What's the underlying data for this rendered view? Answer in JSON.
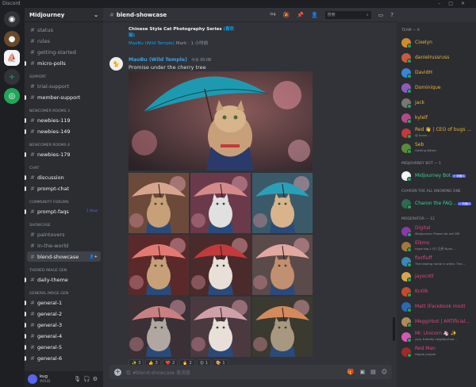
{
  "window": {
    "title": "Discord"
  },
  "server": {
    "name": "Midjourney"
  },
  "channel_categories": [
    {
      "name": "",
      "channels": [
        {
          "name": "status",
          "state": "normal"
        },
        {
          "name": "rules",
          "state": "normal"
        },
        {
          "name": "getting-started",
          "state": "normal"
        },
        {
          "name": "micro-polls",
          "state": "unread"
        }
      ]
    },
    {
      "name": "SUPPORT",
      "channels": [
        {
          "name": "trial-support",
          "state": "normal"
        },
        {
          "name": "member-support",
          "state": "unread"
        }
      ]
    },
    {
      "name": "NEWCOMER ROOMS 3",
      "channels": [
        {
          "name": "newbies-119",
          "state": "unread"
        },
        {
          "name": "newbies-149",
          "state": "unread"
        }
      ]
    },
    {
      "name": "NEWCOMER ROOMS 4",
      "channels": [
        {
          "name": "newbies-179",
          "state": "unread"
        }
      ]
    },
    {
      "name": "CHAT",
      "channels": [
        {
          "name": "discussion",
          "state": "unread"
        },
        {
          "name": "prompt-chat",
          "state": "unread"
        }
      ]
    },
    {
      "name": "COMMUNITY FORUMS",
      "channels": [
        {
          "name": "prompt-faqs",
          "state": "unread",
          "badge": "1 New"
        }
      ]
    },
    {
      "name": "SHOWCASE",
      "channels": [
        {
          "name": "paintovers",
          "state": "normal"
        },
        {
          "name": "in-the-world",
          "state": "normal"
        },
        {
          "name": "blend-showcase",
          "state": "active"
        }
      ]
    },
    {
      "name": "THEMED IMAGE GEN",
      "channels": [
        {
          "name": "daily-theme",
          "state": "unread"
        }
      ]
    },
    {
      "name": "GENERAL IMAGE GEN",
      "channels": [
        {
          "name": "general-1",
          "state": "unread"
        },
        {
          "name": "general-2",
          "state": "unread"
        },
        {
          "name": "general-3",
          "state": "unread"
        },
        {
          "name": "general-4",
          "state": "unread"
        },
        {
          "name": "general-5",
          "state": "unread"
        },
        {
          "name": "general-6",
          "state": "unread"
        }
      ]
    }
  ],
  "user": {
    "name": "kug",
    "tag": "#0142"
  },
  "header": {
    "channel": "blend-showcase",
    "thread_count": "4",
    "search_placeholder": "搜索"
  },
  "reply": {
    "title": "Chinese Style Cat Photography Series",
    "title_tag": "(喜欢猫)",
    "author": "MaoBu (Wild Temple)",
    "author_suffix": "Mark",
    "time": "1 小时前"
  },
  "message": {
    "author": "MaoBu (Wild Temple)",
    "timestamp": "今天 00:08",
    "text": "Promise under the cherry tree"
  },
  "reactions": [
    {
      "emoji": "✨",
      "count": "3"
    },
    {
      "emoji": "👍",
      "count": "3"
    },
    {
      "emoji": "❤️",
      "count": "2"
    },
    {
      "emoji": "🔥",
      "count": "2"
    },
    {
      "emoji": "😮",
      "count": "1"
    },
    {
      "emoji": "🎨",
      "count": "1"
    }
  ],
  "composer": {
    "placeholder": "给 #blend-showcase 发消息"
  },
  "member_groups": [
    {
      "name": "TEAM — 9",
      "members": [
        {
          "name": "Cixelyn",
          "color": "#f0b232",
          "avatar": "#d18b2c"
        },
        {
          "name": "danielrussruss",
          "color": "#f0b232",
          "avatar": "#c65b3f"
        },
        {
          "name": "DavidH",
          "color": "#f0b232",
          "avatar": "#3a84d6"
        },
        {
          "name": "Dominique",
          "color": "#f0b232",
          "avatar": "#8a5cc2"
        },
        {
          "name": "jack",
          "color": "#f0b232",
          "avatar": "#777777"
        },
        {
          "name": "kylelf",
          "color": "#f0b232",
          "avatar": "#b04a8a"
        },
        {
          "name": "Red 👋 | CEO of bugs ...",
          "color": "#f0b232",
          "avatar": "#c23a3a",
          "status": "@ kunsr ..."
        },
        {
          "name": "Seb",
          "color": "#f0b232",
          "avatar": "#5c8a3a",
          "status": "Getting Better"
        }
      ]
    },
    {
      "name": "MIDJOURNEY BOT — 1",
      "members": [
        {
          "name": "Midjourney Bot",
          "color": "#3ecf8e",
          "avatar": "#f2f3f5",
          "bot": "✓ 机器人"
        }
      ]
    },
    {
      "name": "CHARON THE ALL KNOWING ONE",
      "members": [
        {
          "name": "Charon the FAQ...",
          "color": "#3ecf8e",
          "avatar": "#2d6a4f",
          "bot": "✓ 机器人"
        }
      ]
    },
    {
      "name": "MODERATOR — 12",
      "members": [
        {
          "name": "Digital",
          "color": "#e0457b",
          "avatar": "#8a3aa8",
          "status": "Midjourney: Please do not DM"
        },
        {
          "name": "Elkmo",
          "color": "#e0457b",
          "avatar": "#a07a3a",
          "status": "Hype top-1 DT 正经 Nyan..."
        },
        {
          "name": "fiorfluff",
          "color": "#e0457b",
          "avatar": "#3a8ab0",
          "status": "The leading horse is white. The..."
        },
        {
          "name": "jayscott",
          "color": "#e0457b",
          "avatar": "#d4a84a"
        },
        {
          "name": "Kn0lk",
          "color": "#e0457b",
          "avatar": "#c84a2a"
        },
        {
          "name": "Matt (Facebook mod)",
          "color": "#e0457b",
          "avatar": "#2a6ab0"
        },
        {
          "name": "Meggirbot | ARTificial...",
          "color": "#e0457b",
          "avatar": "#b08a5a"
        },
        {
          "name": "Mr. Unicorn 🦄 ✨",
          "color": "#e0457b",
          "avatar": "#d45ab0",
          "status": "your friendly neighborhoo..."
        },
        {
          "name": "Red Man",
          "color": "#e0457b",
          "avatar": "#a02a2a",
          "status": "Hippie Juniper"
        }
      ]
    }
  ]
}
